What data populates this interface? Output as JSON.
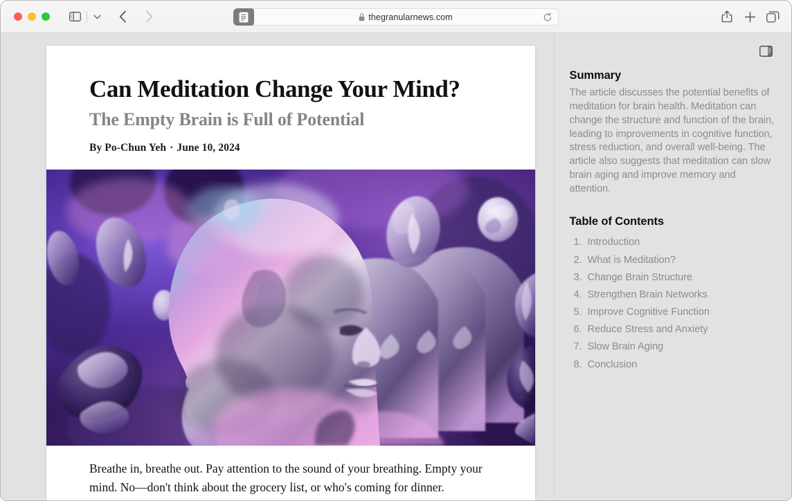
{
  "window": {
    "traffic_lights": [
      {
        "name": "close",
        "color": "#ff5f57"
      },
      {
        "name": "minimize",
        "color": "#febc2e"
      },
      {
        "name": "zoom",
        "color": "#28c840"
      }
    ]
  },
  "toolbar": {
    "sidebar_icon": "sidebar-icon",
    "chevron_icon": "chevron-down-icon",
    "back_icon": "back-chevron-icon",
    "forward_icon": "forward-chevron-icon",
    "reader_icon": "reader-mode-icon",
    "lock_icon": "lock-icon",
    "url": "thegranularnews.com",
    "reload_icon": "reload-icon",
    "share_icon": "share-icon",
    "new_tab_icon": "plus-icon",
    "tab_overview_icon": "tab-overview-icon"
  },
  "article": {
    "title": "Can Meditation Change Your Mind?",
    "subtitle": "The Empty Brain is Full of Potential",
    "byline_author": "By Po-Chun Yeh",
    "byline_separator": "·",
    "byline_date": "June 10, 2024",
    "hero_image_alt": "Abstract rendering of repeating bald human heads in profile against purple and violet gradients with floating glossy blobs",
    "body_paragraph": "Breathe in, breathe out. Pay attention to the sound of your breathing. Empty your mind. No—don't think about the grocery list, or who's coming for dinner."
  },
  "sidebar": {
    "toggle_icon": "sidebar-toggle-icon",
    "summary_heading": "Summary",
    "summary_text": "The article discusses the potential benefits of meditation for brain health. Meditation can change the structure and function of the brain, leading to improvements in cognitive function, stress reduction, and overall well-being. The article also suggests that meditation can slow brain aging and improve memory and attention.",
    "toc_heading": "Table of Contents",
    "toc_items": [
      {
        "number": "1.",
        "label": "Introduction"
      },
      {
        "number": "2.",
        "label": "What is Meditation?"
      },
      {
        "number": "3.",
        "label": "Change Brain Structure"
      },
      {
        "number": "4.",
        "label": "Strengthen Brain Networks"
      },
      {
        "number": "5.",
        "label": "Improve Cognitive Function"
      },
      {
        "number": "6.",
        "label": "Reduce Stress and Anxiety"
      },
      {
        "number": "7.",
        "label": "Slow Brain Aging"
      },
      {
        "number": "8.",
        "label": "Conclusion"
      }
    ]
  },
  "colors": {
    "window_chrome": "#f3f3f3",
    "page_background": "#e2e2e2",
    "card_background": "#ffffff",
    "muted_text": "#8c8c8c",
    "heading_text": "#101010",
    "hero_purple_deep": "#2a1254",
    "hero_purple_mid": "#5b3fa8",
    "hero_violet": "#7c4bd0",
    "hero_pink": "#e09ae0",
    "hero_light": "#ded3ef"
  }
}
